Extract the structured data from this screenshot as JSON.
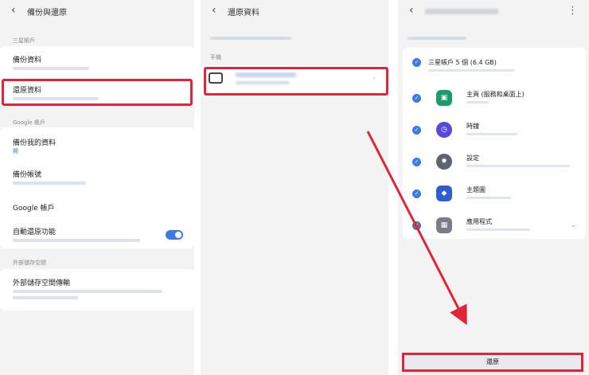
{
  "panel1": {
    "title": "備份與還原",
    "section_phone": "三星帳戶",
    "backup_label": "備份資料",
    "restore_label": "還原資料",
    "section_google": "Google 帳戶",
    "google_backup_label": "備份我的資料",
    "google_backup_value": "開",
    "backup_account_label": "備份帳號",
    "google_account_label": "Google 帳戶",
    "auto_restore_label": "自動還原功能",
    "auto_restore_on": true,
    "section_external": "外部儲存空間",
    "external_transfer_label": "外部儲存空間傳輸"
  },
  "panel2": {
    "title": "還原資料",
    "section_label": "手機"
  },
  "panel3": {
    "apps": [
      {
        "title": "三星帳戶 5 個 (6.4 GB)",
        "icon": "group-icon",
        "color": "#3e7ae6"
      },
      {
        "title": "主頁 (服務和桌面上)",
        "icon": "home-app-icon",
        "color": "#1d9b6c"
      },
      {
        "title": "時鐘",
        "icon": "clock-app-icon",
        "color": "#5a48d6"
      },
      {
        "title": "設定",
        "icon": "settings-app-icon",
        "color": "#5c6470"
      },
      {
        "title": "主題圖",
        "icon": "theme-app-icon",
        "color": "#2f5fcf"
      },
      {
        "title": "應用程式",
        "icon": "apps-grid-icon",
        "color": "#7a7f87"
      }
    ],
    "restore_button_label": "還原"
  }
}
